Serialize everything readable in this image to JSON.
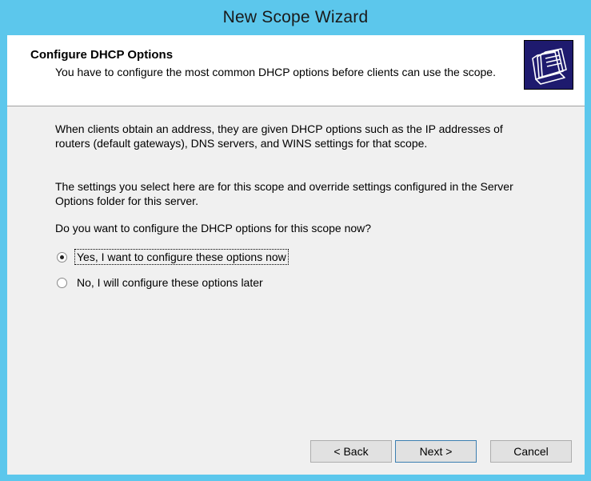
{
  "window": {
    "title": "New Scope Wizard"
  },
  "header": {
    "title": "Configure DHCP Options",
    "subtitle": "You have to configure the most common DHCP options before clients can use the scope."
  },
  "body": {
    "paragraph1": "When clients obtain an address, they are given DHCP options such as the IP addresses of routers (default gateways), DNS servers, and WINS settings for that scope.",
    "paragraph2": "The settings you select here are for this scope and override settings configured in the Server Options folder for this server.",
    "question": "Do you want to configure the DHCP options for this scope now?"
  },
  "options": [
    {
      "label": "Yes, I want to configure these options now",
      "selected": true
    },
    {
      "label": "No, I will configure these options later",
      "selected": false
    }
  ],
  "buttons": {
    "back": "< Back",
    "next": "Next >",
    "cancel": "Cancel"
  },
  "colors": {
    "frame": "#5cc7ec",
    "client_bg": "#f0f0f0",
    "header_bg": "#ffffff",
    "icon_bg": "#1e1a6e"
  }
}
